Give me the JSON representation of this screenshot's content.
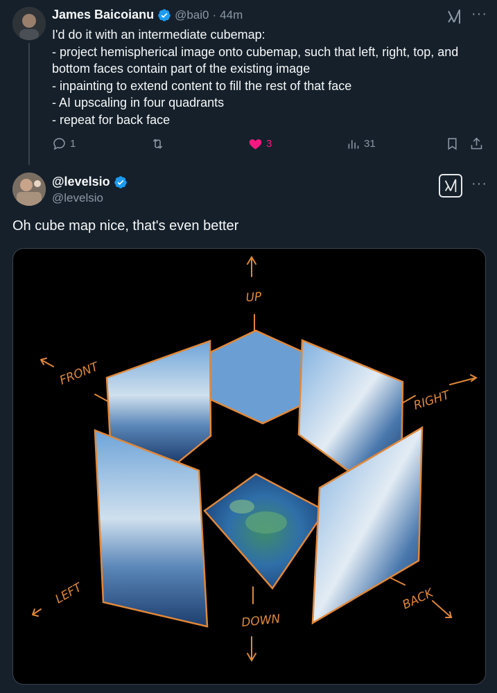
{
  "tweet1": {
    "author_name": "James Baicoianu",
    "handle": "@bai0",
    "separator": "·",
    "time": "44m",
    "text": "I'd do it with an intermediate cubemap:\n- project hemispherical image onto cubemap, such that left, right, top, and bottom faces contain part of the existing image\n- inpainting to extend content to fill the rest of that face\n- AI upscaling in four quadrants\n- repeat for back face",
    "replies": "1",
    "likes": "3",
    "views": "31"
  },
  "tweet2": {
    "author_name": "@levelsio",
    "handle": "@levelsio",
    "text": "Oh cube map nice, that's even better"
  },
  "diagram": {
    "labels": {
      "up": "UP",
      "front": "FRONT",
      "right": "RIGHT",
      "left": "LEFT",
      "down": "DOWN",
      "back": "BACK"
    }
  },
  "colors": {
    "background": "#15202b",
    "accent_like": "#f91880",
    "verified": "#1d9bf0",
    "text_muted": "#8b98a5",
    "diagram_orange": "#e0883a"
  }
}
